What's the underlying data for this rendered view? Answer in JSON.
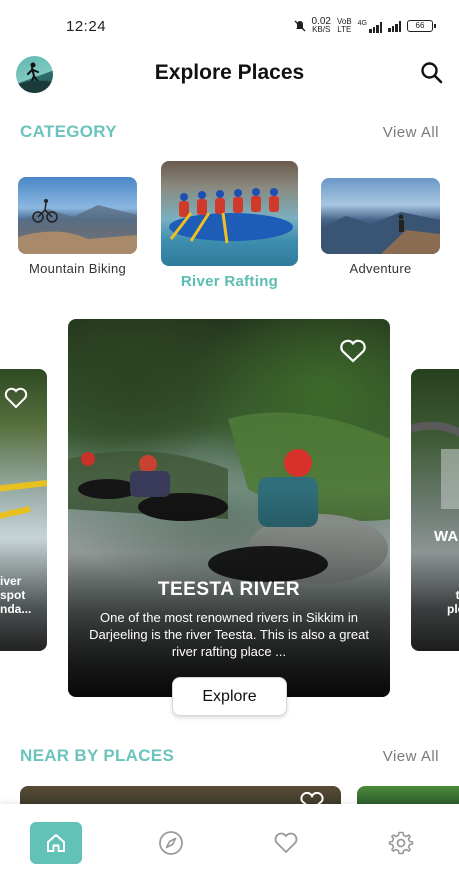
{
  "status_bar": {
    "time": "12:24",
    "net_speed": "0.02",
    "net_unit": "KB/S",
    "volte": "VoB",
    "lte": "LTE",
    "signal_4g": "4G",
    "battery": "66"
  },
  "header": {
    "title": "Explore Places"
  },
  "category": {
    "title": "CATEGORY",
    "view_all": "View All",
    "items": [
      {
        "label": "Mountain Biking"
      },
      {
        "label": "River Rafting"
      },
      {
        "label": "Adventure"
      }
    ]
  },
  "carousel": {
    "main": {
      "title": "TEESTA RIVER",
      "description": "One of the most renowned rivers in Sikkim in Darjeeling is the river Teesta. This is also a great river rafting place ...",
      "button": "Explore"
    },
    "left_peek": {
      "lines": [
        "iver",
        "spot",
        "nda..."
      ]
    },
    "right_peek": {
      "title": "WA",
      "lines": [
        "T",
        "tra",
        "plea"
      ]
    }
  },
  "near_by": {
    "title": "NEAR BY PLACES",
    "view_all": "View All"
  },
  "colors": {
    "accent": "#63c2b8",
    "section_title": "#6cc3bd",
    "muted": "#7a7a7a"
  },
  "icons": {
    "search": "search-icon",
    "heart": "heart-outline-icon",
    "home": "home-icon",
    "explore": "compass-icon",
    "favorites": "heart-icon",
    "settings": "gear-icon"
  }
}
